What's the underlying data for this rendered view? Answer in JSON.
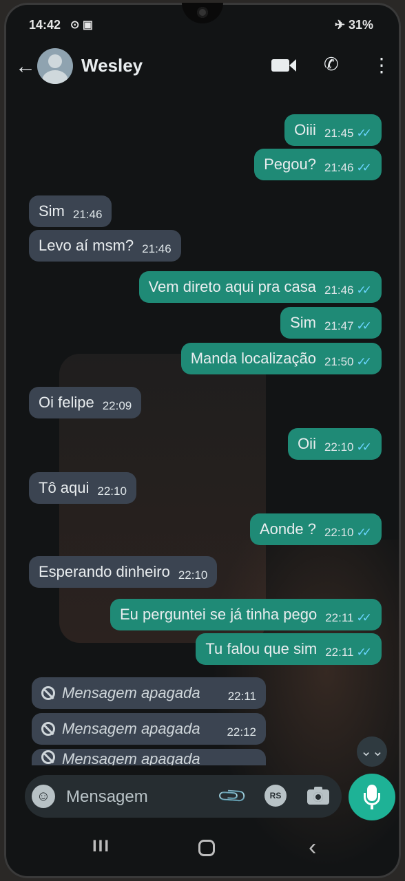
{
  "status_bar": {
    "time": "14:42",
    "left_icons": "⊙ ▣",
    "right_text": "✈ 31%"
  },
  "header": {
    "back_icon": "←",
    "contact_name": "Wesley",
    "call_icon": "✆",
    "menu_icon": "⋮"
  },
  "messages": [
    {
      "dir": "out",
      "text": "Oiii",
      "time": "21:45"
    },
    {
      "dir": "out",
      "text": "Pegou?",
      "time": "21:46"
    },
    {
      "dir": "in",
      "text": "Sim",
      "time": "21:46"
    },
    {
      "dir": "in",
      "text": "Levo aí msm?",
      "time": "21:46"
    },
    {
      "dir": "out",
      "text": "Vem direto aqui pra casa",
      "time": "21:46"
    },
    {
      "dir": "out",
      "text": "Sim",
      "time": "21:47"
    },
    {
      "dir": "out",
      "text": "Manda localização",
      "time": "21:50"
    },
    {
      "dir": "in",
      "text": "Oi felipe",
      "time": "22:09"
    },
    {
      "dir": "out",
      "text": "Oii",
      "time": "22:10"
    },
    {
      "dir": "in",
      "text": "Tô aqui",
      "time": "22:10"
    },
    {
      "dir": "out",
      "text": "Aonde ?",
      "time": "22:10"
    },
    {
      "dir": "in",
      "text": "Esperando dinheiro",
      "time": "22:10"
    },
    {
      "dir": "out",
      "text": "Eu perguntei se já tinha pego",
      "time": "22:11"
    },
    {
      "dir": "out",
      "text": "Tu falou que sim",
      "time": "22:11"
    },
    {
      "dir": "deleted",
      "text": "Mensagem apagada",
      "time": "22:11"
    },
    {
      "dir": "deleted",
      "text": "Mensagem apagada",
      "time": "22:12"
    },
    {
      "dir": "deleted",
      "text": "Mensagem apagada",
      "time": ""
    }
  ],
  "read_ticks": "✓✓",
  "scroll_icon": "⌄⌄",
  "input": {
    "placeholder": "Mensagem",
    "emoji_icon": "☺",
    "attach_icon": "📎",
    "rs_label": "RS"
  },
  "nav": {
    "recents": "III",
    "back": "‹"
  },
  "colors": {
    "outgoing_bubble": "#1f8a76",
    "incoming_bubble": "#3b4451",
    "read_ticks": "#6ad4ff",
    "mic_button": "#1eb296"
  }
}
